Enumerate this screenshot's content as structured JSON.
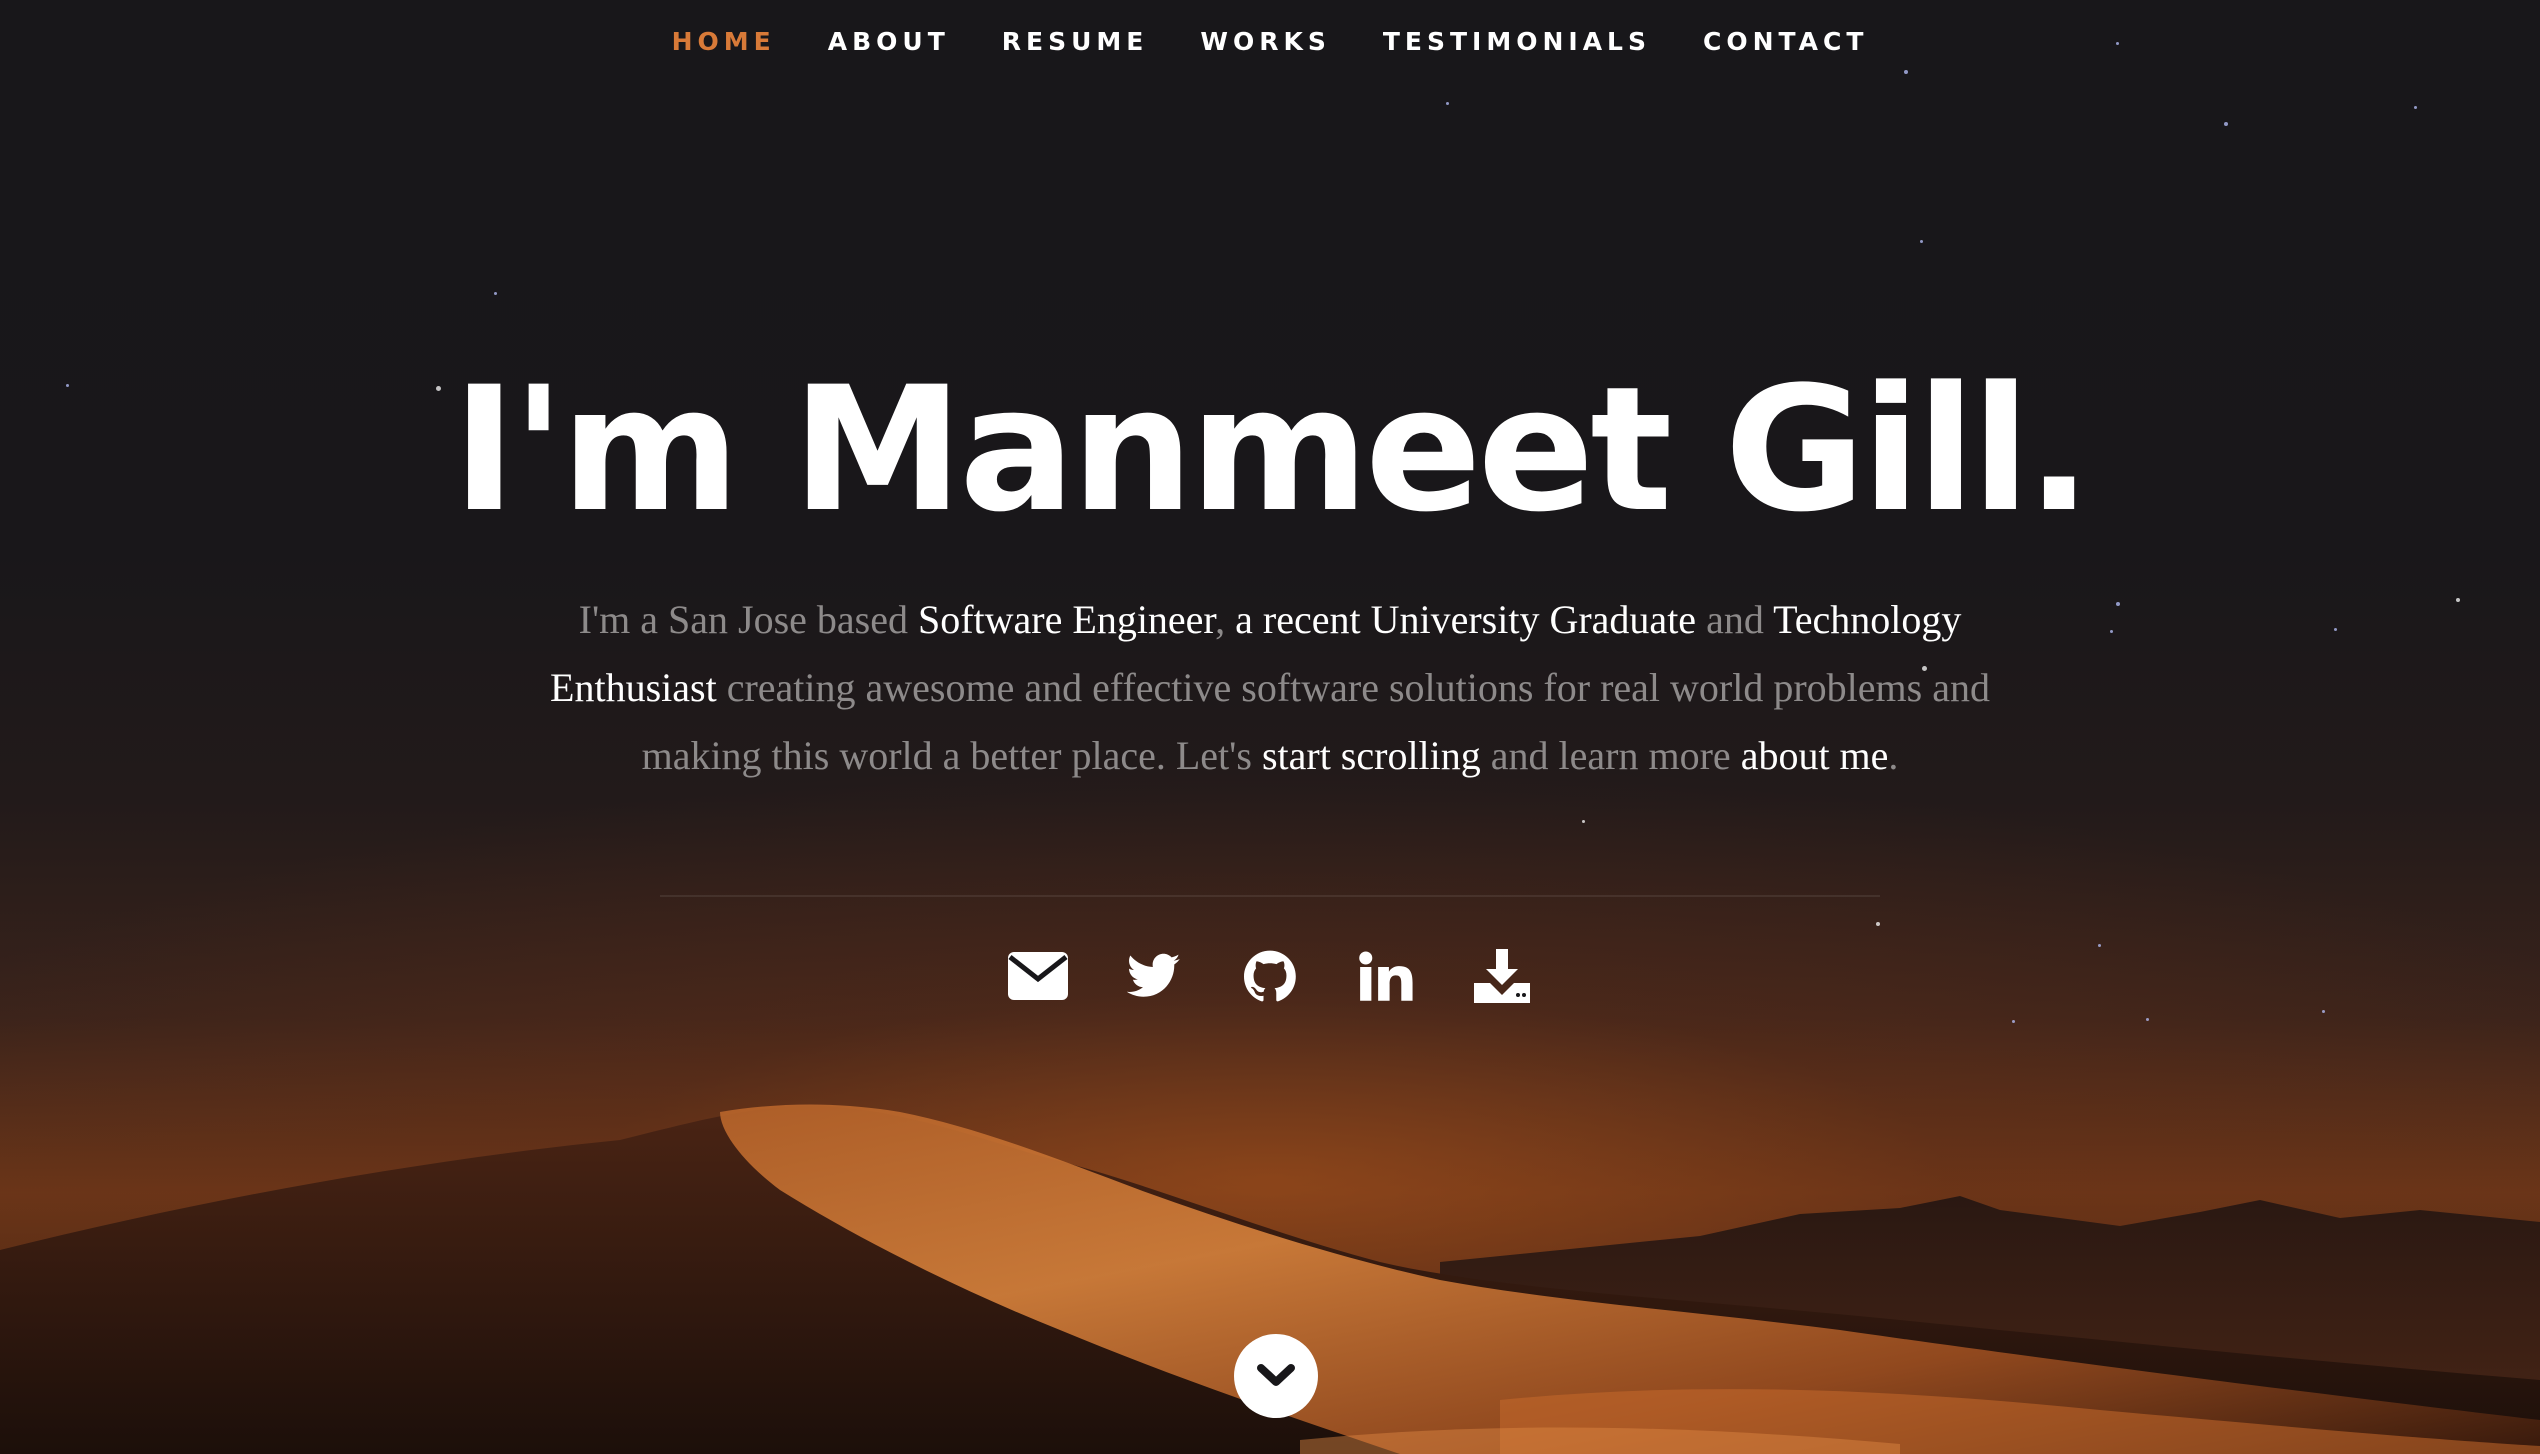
{
  "nav": {
    "items": [
      {
        "label": "HOME",
        "active": true
      },
      {
        "label": "ABOUT",
        "active": false
      },
      {
        "label": "RESUME",
        "active": false
      },
      {
        "label": "WORKS",
        "active": false
      },
      {
        "label": "TESTIMONIALS",
        "active": false
      },
      {
        "label": "CONTACT",
        "active": false
      }
    ]
  },
  "hero": {
    "title": "I'm Manmeet Gill.",
    "bio": {
      "p1": "I'm a San Jose based ",
      "h1": "Software Engineer",
      "p2": ", ",
      "h2": "a recent University Graduate",
      "p3": " and ",
      "h3": "Technology Enthusiast",
      "p4": " creating awesome and effective software solutions for real world problems and making this world a better place. Let's ",
      "link1": "start scrolling",
      "p5": " and learn more ",
      "link2": "about me",
      "p6": "."
    }
  },
  "social": {
    "items": [
      {
        "icon": "envelope-icon",
        "name": "email"
      },
      {
        "icon": "twitter-icon",
        "name": "twitter"
      },
      {
        "icon": "github-icon",
        "name": "github"
      },
      {
        "icon": "linkedin-icon",
        "name": "linkedin"
      },
      {
        "icon": "download-icon",
        "name": "download-resume"
      }
    ]
  },
  "colors": {
    "accent": "#d87a38",
    "text": "#ffffff",
    "muted": "#8d8a8a",
    "background": "#18171a"
  }
}
